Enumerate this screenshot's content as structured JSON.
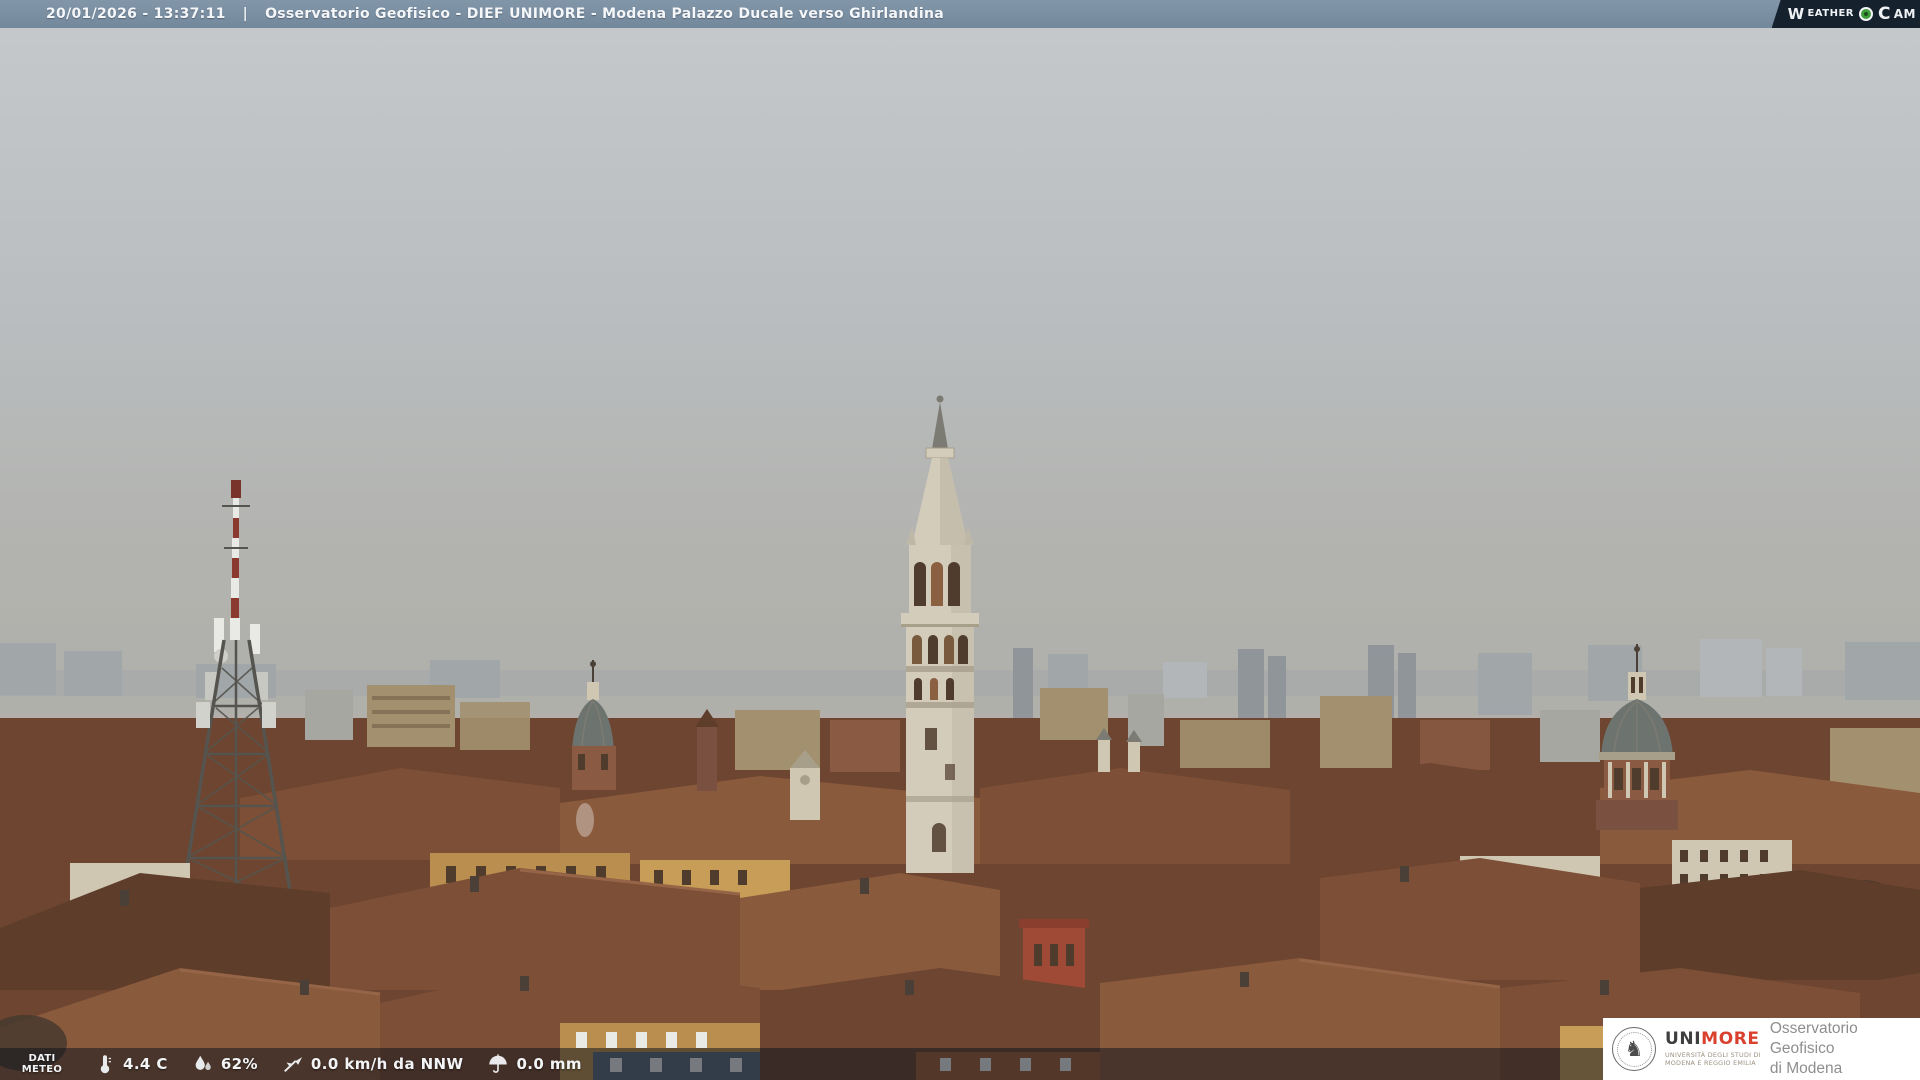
{
  "header": {
    "timestamp": "20/01/2026 - 13:37:11",
    "separator": "|",
    "title": "Osservatorio Geofisico - DIEF UNIMORE - Modena Palazzo Ducale verso Ghirlandina",
    "weathercam": {
      "word1_initial": "W",
      "word1_rest": "EATHER",
      "word2_initial": "C",
      "word2_rest": "AM"
    }
  },
  "weather_bar": {
    "label_line1": "DATI",
    "label_line2": "METEO",
    "temperature": "4.4 C",
    "humidity": "62%",
    "wind": "0.0 km/h da NNW",
    "precipitation": "0.0 mm",
    "icons": {
      "temperature": "thermometer-icon",
      "humidity": "droplets-icon",
      "wind": "wind-vane-icon",
      "precipitation": "umbrella-icon"
    }
  },
  "branding": {
    "seal_glyph": "♞",
    "acronym_left": "UNI",
    "acronym_right": "MORE",
    "university_line1": "UNIVERSITÀ DEGLI STUDI DI",
    "university_line2": "MODENA E REGGIO EMILIA",
    "observatory_line1": "Osservatorio Geofisico",
    "observatory_line2": "di Modena"
  },
  "scene": {
    "landmarks": [
      "telecom-lattice-mast",
      "ghirlandina-tower",
      "voto-church-dome",
      "san-domenico-dome"
    ],
    "colors": {
      "topbar1": "#8296aa",
      "topbar2": "#74889c",
      "logo_bg": "#16212e",
      "logo_green": "#3f9e3a",
      "overlay": "rgba(14,20,28,0.52)",
      "sky_top": "#c4c8ca",
      "sky_mid": "#b9bdbf",
      "sky_low": "#b2b2ae",
      "sky_horizon": "#b3b0ab",
      "far": "#99a0a8",
      "far_dark": "#7e8691",
      "far_light": "#b6bac0",
      "haze": "#aeafab",
      "stone": "#d3ccba",
      "stone_shade": "#c0b8a6",
      "stone_dark": "#a89f8b",
      "lead": "#6d736e",
      "spire_dark": "#7b7b73",
      "brick": "#8a5a43",
      "brick_dark": "#7a5040",
      "roof1": "#7c4f36",
      "roof2": "#6d4530",
      "roof3": "#8a5a3c",
      "roof4": "#5f3d2b",
      "roof5": "#966548",
      "wall_ochre": "#b98e4e",
      "wall_ochre2": "#c79d58",
      "wall_cream": "#cfc7b2",
      "wall_red": "#9e4a36",
      "wall_tan": "#a3906f",
      "wall_grey": "#a7a7a1",
      "slate": "#5d6c7c",
      "facade_orange": "#a0603a",
      "dark": "#4a4038",
      "metal": "#55544e",
      "white": "#e9e9e5",
      "window": "#4f3c2c",
      "tree": "#463a2f",
      "uni_dark": "#3f3f3f",
      "uni_red": "#d9412e",
      "uni_sub": "#9b9180",
      "obs_grey": "#8e8e8e",
      "seal": "#4c4c4c"
    }
  }
}
